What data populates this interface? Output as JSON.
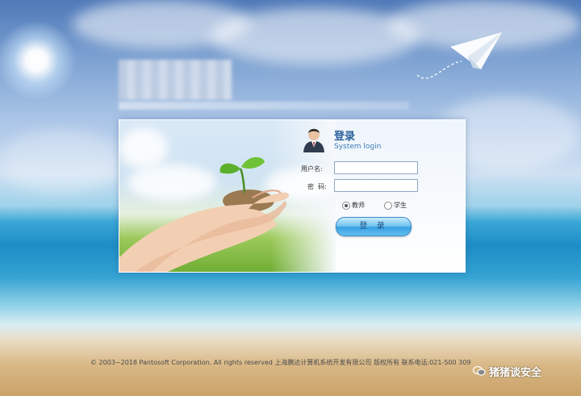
{
  "panel": {
    "title_cn": "登录",
    "title_en": "System login",
    "username_label": "用户名:",
    "password_label": "密  码:",
    "role_options": [
      "教师",
      "学生"
    ],
    "selected_role": "教师",
    "login_button": "登 录",
    "icons": {
      "avatar": "user-avatar-icon"
    }
  },
  "footer": {
    "copyright": "© 2003~2018 Pantosoft Corporation. All rights reserved 上海鹏达计算机系统开发有限公司 版权所有 联系电话:021-500  309"
  },
  "watermark": {
    "text": "猪猪谈安全",
    "icon": "wechat-icon"
  },
  "colors": {
    "title": "#2a5f9a",
    "button": "#3aa1e2"
  }
}
